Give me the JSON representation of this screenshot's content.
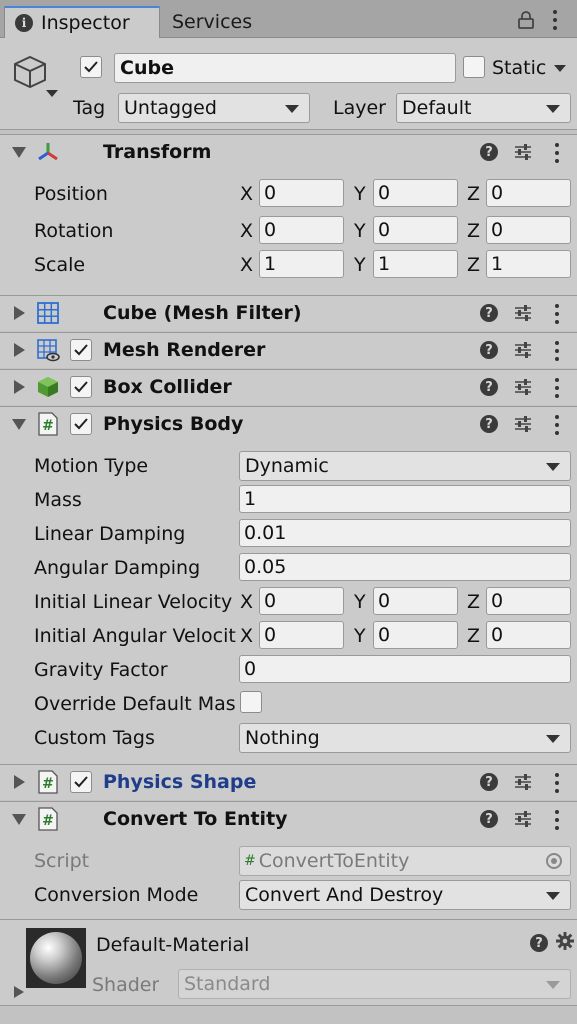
{
  "tabs": {
    "inspector": "Inspector",
    "services": "Services"
  },
  "object": {
    "name": "Cube",
    "active": true,
    "static_label": "Static",
    "static_checked": false,
    "tag_label": "Tag",
    "tag_value": "Untagged",
    "layer_label": "Layer",
    "layer_value": "Default"
  },
  "axes": {
    "x": "X",
    "y": "Y",
    "z": "Z"
  },
  "help_glyph": "?",
  "transform": {
    "title": "Transform",
    "position_label": "Position",
    "position": [
      "0",
      "0",
      "0"
    ],
    "rotation_label": "Rotation",
    "rotation": [
      "0",
      "0",
      "0"
    ],
    "scale_label": "Scale",
    "scale": [
      "1",
      "1",
      "1"
    ]
  },
  "components": {
    "mesh_filter": {
      "title": "Cube (Mesh Filter)"
    },
    "mesh_renderer": {
      "title": "Mesh Renderer",
      "enabled": true
    },
    "box_collider": {
      "title": "Box Collider",
      "enabled": true
    },
    "physics_body": {
      "title": "Physics Body",
      "enabled": true,
      "motion_type_label": "Motion Type",
      "motion_type": "Dynamic",
      "mass_label": "Mass",
      "mass": "1",
      "linear_damping_label": "Linear Damping",
      "linear_damping": "0.01",
      "angular_damping_label": "Angular Damping",
      "angular_damping": "0.05",
      "initial_linear_velocity_label": "Initial Linear Velocity",
      "initial_linear_velocity": [
        "0",
        "0",
        "0"
      ],
      "initial_angular_velocity_label": "Initial Angular Velocity",
      "initial_angular_velocity": [
        "0",
        "0",
        "0"
      ],
      "gravity_factor_label": "Gravity Factor",
      "gravity_factor": "0",
      "override_default_mass_label": "Override Default Mass",
      "override_default_mass": false,
      "custom_tags_label": "Custom Tags",
      "custom_tags": "Nothing"
    },
    "physics_shape": {
      "title": "Physics Shape",
      "enabled": true
    },
    "convert_to_entity": {
      "title": "Convert To Entity",
      "script_label": "Script",
      "script_value": "ConvertToEntity",
      "conversion_mode_label": "Conversion Mode",
      "conversion_mode": "Convert And Destroy"
    }
  },
  "material": {
    "name": "Default-Material",
    "shader_label": "Shader",
    "shader_value": "Standard"
  },
  "colors": {
    "panel_bg": "#cbcbcb",
    "accent_tab": "#4a86d8",
    "script_icon": "#2e7d2e",
    "physics_shape_title": "#1f3d8a"
  }
}
